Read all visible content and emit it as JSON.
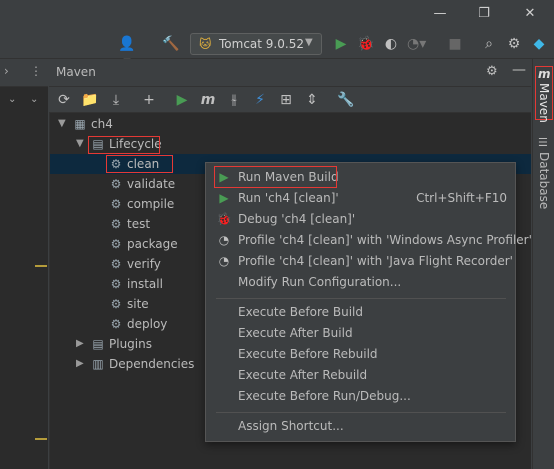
{
  "titlebar": {
    "minimize_icon": "minimize-icon",
    "restore_icon": "restore-icon",
    "close_icon": "close-icon"
  },
  "toolbar": {
    "run_config": "Tomcat 9.0.52"
  },
  "panel": {
    "title": "Maven",
    "project": "ch4",
    "lifecycle_label": "Lifecycle",
    "lifecycle_items": [
      "clean",
      "validate",
      "compile",
      "test",
      "package",
      "verify",
      "install",
      "site",
      "deploy"
    ],
    "plugins_label": "Plugins",
    "dependencies_label": "Dependencies"
  },
  "right_tabs": {
    "maven": "Maven",
    "database": "Database"
  },
  "context_menu": {
    "items": [
      {
        "label": "Run Maven Build",
        "icon": "run-icon",
        "shortcut": ""
      },
      {
        "label": "Run 'ch4 [clean]'",
        "icon": "run-icon",
        "shortcut": "Ctrl+Shift+F10"
      },
      {
        "label": "Debug 'ch4 [clean]'",
        "icon": "debug-icon",
        "shortcut": ""
      },
      {
        "label": "Profile 'ch4 [clean]' with 'Windows Async Profiler'",
        "icon": "profile-icon",
        "shortcut": ""
      },
      {
        "label": "Profile 'ch4 [clean]' with 'Java Flight Recorder'",
        "icon": "profile-icon",
        "shortcut": ""
      },
      {
        "label": "Modify Run Configuration...",
        "icon": "",
        "shortcut": ""
      },
      {
        "label": "Execute Before Build",
        "icon": "",
        "shortcut": ""
      },
      {
        "label": "Execute After Build",
        "icon": "",
        "shortcut": ""
      },
      {
        "label": "Execute Before Rebuild",
        "icon": "",
        "shortcut": ""
      },
      {
        "label": "Execute After Rebuild",
        "icon": "",
        "shortcut": ""
      },
      {
        "label": "Execute Before Run/Debug...",
        "icon": "",
        "shortcut": ""
      },
      {
        "label": "Assign Shortcut...",
        "icon": "",
        "shortcut": ""
      }
    ]
  },
  "colors": {
    "accent_green": "#499c54",
    "highlight_red": "#e53935",
    "selection": "#0d293e"
  }
}
